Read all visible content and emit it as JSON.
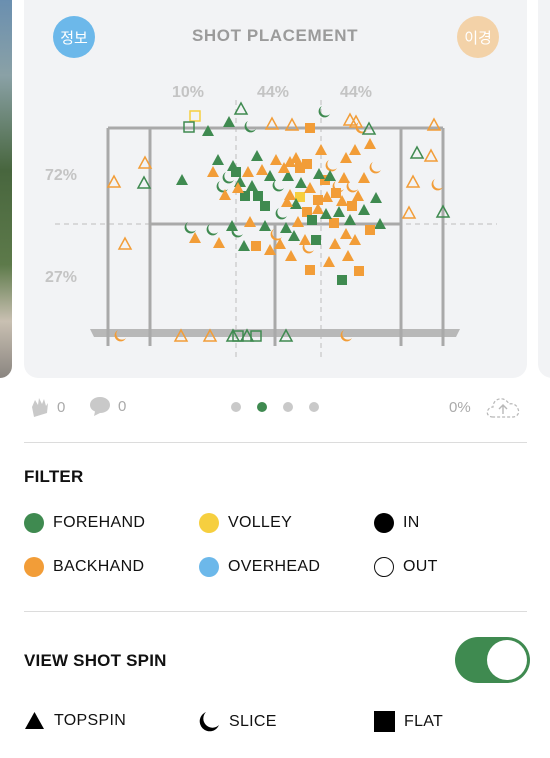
{
  "colors": {
    "forehand": "#3f8a50",
    "backhand": "#f29d38",
    "volley": "#f6cf3f",
    "overhead": "#6cb8ea",
    "in": "#000000",
    "out": "#ffffff",
    "court_line": "#a9a9a9",
    "toggle_on": "#3f8a50"
  },
  "card": {
    "title": "SHOT PLACEMENT",
    "left_button": "정보",
    "right_button": "이경",
    "depth_pcts": [
      "10%",
      "44%",
      "44%"
    ],
    "side_pcts": [
      "72%",
      "27%"
    ]
  },
  "social": {
    "likes_icon": "clap-icon",
    "likes": "0",
    "comments_icon": "comment-icon",
    "comments": "0",
    "upload_pct": "0%",
    "upload_icon": "cloud-upload-icon"
  },
  "pager": {
    "count": 4,
    "active_index": 1
  },
  "filter": {
    "title": "FILTER",
    "items": [
      {
        "label": "FOREHAND",
        "swatch": "forehand"
      },
      {
        "label": "VOLLEY",
        "swatch": "volley"
      },
      {
        "label": "IN",
        "swatch": "in"
      },
      {
        "label": "BACKHAND",
        "swatch": "backhand"
      },
      {
        "label": "OVERHEAD",
        "swatch": "overhead"
      },
      {
        "label": "OUT",
        "swatch": "out"
      }
    ]
  },
  "spin": {
    "title": "VIEW SHOT SPIN",
    "toggle_on": true,
    "legend": [
      {
        "label": "TOPSPIN",
        "icon": "triangle-icon"
      },
      {
        "label": "SLICE",
        "icon": "crescent-icon"
      },
      {
        "label": "FLAT",
        "icon": "square-icon"
      }
    ]
  }
}
